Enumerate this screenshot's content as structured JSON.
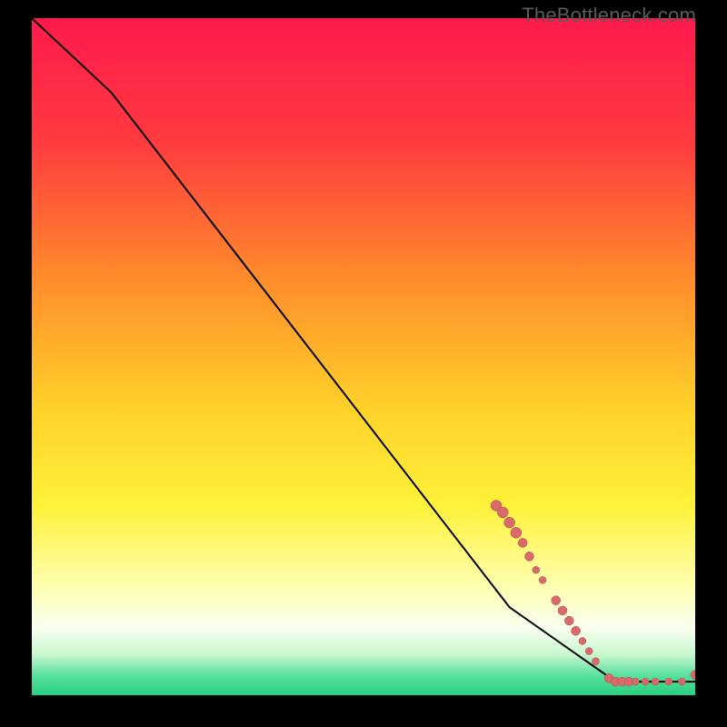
{
  "watermark": "TheBottleneck.com",
  "colors": {
    "gradient_stops": [
      {
        "pct": 0,
        "color": "#ff1a4d"
      },
      {
        "pct": 18,
        "color": "#ff3a3f"
      },
      {
        "pct": 38,
        "color": "#ff8a2b"
      },
      {
        "pct": 58,
        "color": "#ffd22a"
      },
      {
        "pct": 72,
        "color": "#fff23a"
      },
      {
        "pct": 84,
        "color": "#ffffb0"
      },
      {
        "pct": 90,
        "color": "#fafff0"
      },
      {
        "pct": 94,
        "color": "#c9f7cf"
      },
      {
        "pct": 97,
        "color": "#5be0a0"
      },
      {
        "pct": 100,
        "color": "#27d080"
      }
    ],
    "line": "#000000",
    "dot_fill": "#d86a6a",
    "dot_stroke": "#b34e4e"
  },
  "chart_data": {
    "type": "line",
    "title": "",
    "xlabel": "",
    "ylabel": "",
    "xlim": [
      0,
      100
    ],
    "ylim": [
      0,
      100
    ],
    "series": [
      {
        "name": "curve",
        "x": [
          0,
          12,
          72,
          88,
          100
        ],
        "y": [
          100,
          89,
          13,
          2,
          2
        ]
      }
    ],
    "scatter": [
      {
        "name": "segment-a",
        "points": [
          {
            "x": 70,
            "y": 28,
            "r": 6
          },
          {
            "x": 71,
            "y": 27,
            "r": 6
          },
          {
            "x": 72,
            "y": 25.5,
            "r": 6
          },
          {
            "x": 73,
            "y": 24,
            "r": 6
          },
          {
            "x": 74,
            "y": 22.5,
            "r": 5
          },
          {
            "x": 75,
            "y": 20.5,
            "r": 5
          },
          {
            "x": 76,
            "y": 18.5,
            "r": 4
          },
          {
            "x": 77,
            "y": 17,
            "r": 4
          }
        ]
      },
      {
        "name": "segment-b",
        "points": [
          {
            "x": 79,
            "y": 14,
            "r": 5
          },
          {
            "x": 80,
            "y": 12.5,
            "r": 5
          },
          {
            "x": 81,
            "y": 11,
            "r": 5
          },
          {
            "x": 82,
            "y": 9.5,
            "r": 5
          },
          {
            "x": 83,
            "y": 8,
            "r": 4
          },
          {
            "x": 84,
            "y": 6.5,
            "r": 4
          },
          {
            "x": 85,
            "y": 5,
            "r": 4
          }
        ]
      },
      {
        "name": "segment-c",
        "points": [
          {
            "x": 87,
            "y": 2.5,
            "r": 5
          },
          {
            "x": 88,
            "y": 2,
            "r": 5
          },
          {
            "x": 89,
            "y": 2,
            "r": 5
          },
          {
            "x": 90,
            "y": 2,
            "r": 5
          },
          {
            "x": 91,
            "y": 2,
            "r": 4
          },
          {
            "x": 92.5,
            "y": 2,
            "r": 4
          },
          {
            "x": 94,
            "y": 2,
            "r": 4
          },
          {
            "x": 96,
            "y": 2,
            "r": 4
          },
          {
            "x": 98,
            "y": 2,
            "r": 4
          },
          {
            "x": 100,
            "y": 3,
            "r": 5
          }
        ]
      }
    ]
  }
}
